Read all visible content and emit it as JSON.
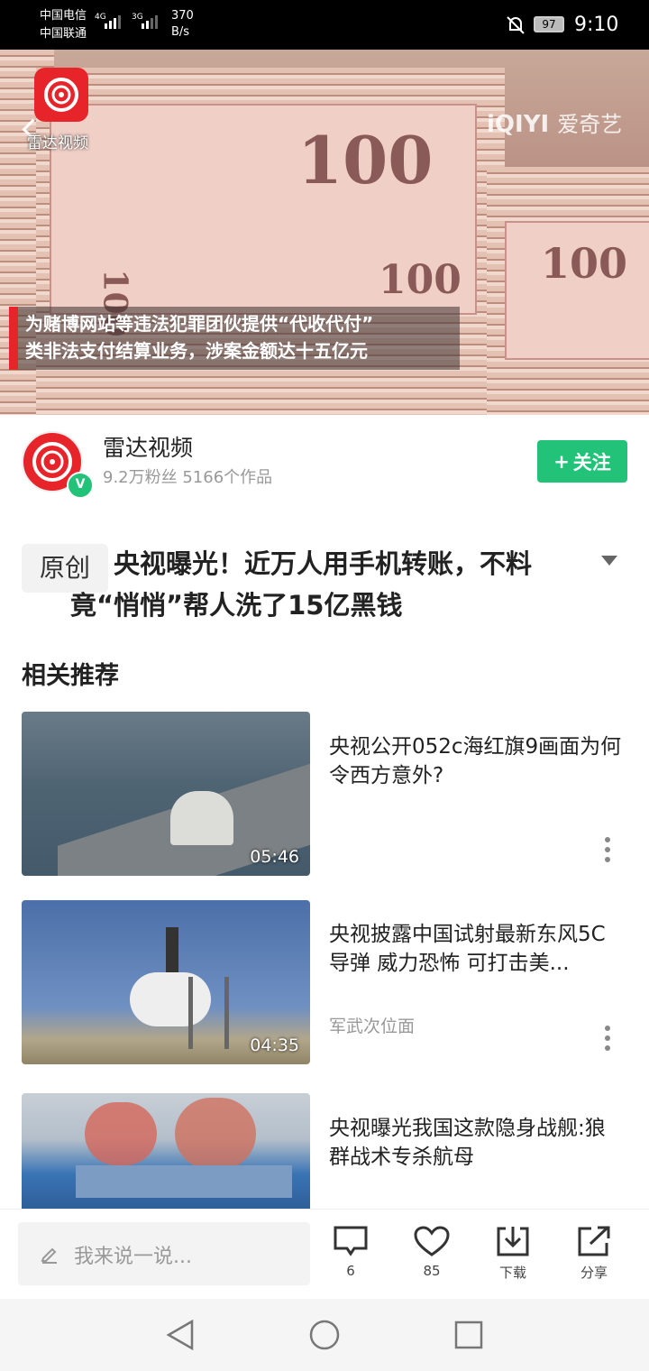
{
  "status_bar": {
    "carrier1": "中国电信",
    "carrier2": "中国联通",
    "net1": "4G",
    "net2": "3G",
    "speed_value": "370",
    "speed_unit": "B/s",
    "battery": "97",
    "time": "9:10"
  },
  "video": {
    "app_label": "雷达视频",
    "watermark": "爱奇艺",
    "watermark_logo": "iQIYI",
    "caption_line1": "为赌博网站等违法犯罪团伙提供“代收代付”",
    "caption_line2": "类非法支付结算业务，涉案金额达十五亿元"
  },
  "author": {
    "name": "雷达视频",
    "meta": "9.2万粉丝 5166个作品",
    "verified_badge": "V",
    "follow_plus": "+",
    "follow_label": "关注"
  },
  "article": {
    "tag": "原创",
    "title": "央视曝光！近万人用手机转账，不料竟“悄悄”帮人洗了15亿黑钱"
  },
  "related": {
    "heading": "相关推荐",
    "items": [
      {
        "title": "央视公开052c海红旗9画面为何令西方意外?",
        "source": "",
        "duration": "05:46"
      },
      {
        "title": "央视披露中国试射最新东风5C导弹 威力恐怖 可打击美...",
        "source": "军武次位面",
        "duration": "04:35"
      },
      {
        "title": "央视曝光我国这款隐身战舰:狼群战术专杀航母",
        "source": "",
        "duration": ""
      }
    ]
  },
  "bottom_bar": {
    "comment_placeholder": "我来说一说...",
    "comments_count": "6",
    "likes_count": "85",
    "download_label": "下载",
    "share_label": "分享"
  },
  "colors": {
    "brand_red": "#e8242b",
    "accent_green": "#22c378"
  }
}
